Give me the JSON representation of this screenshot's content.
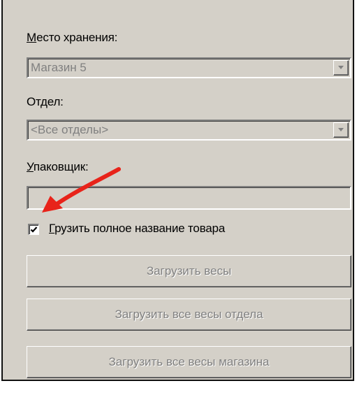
{
  "storage": {
    "label": "Место хранения:",
    "value": "Магазин 5"
  },
  "department": {
    "label": "Отдел:",
    "value": "<Все отделы>"
  },
  "packer": {
    "label": "Упаковщик:",
    "value": ""
  },
  "full_name_checkbox": {
    "label": "Грузить полное название товара",
    "checked": true
  },
  "buttons": {
    "load_scales": "Загрузить весы",
    "load_department_scales": "Загрузить все весы отдела",
    "load_store_scales": "Загрузить все весы магазина"
  },
  "colors": {
    "panel_bg": "#d4d0c8",
    "disabled_text": "#808080",
    "annotation_arrow": "#e8231a"
  }
}
